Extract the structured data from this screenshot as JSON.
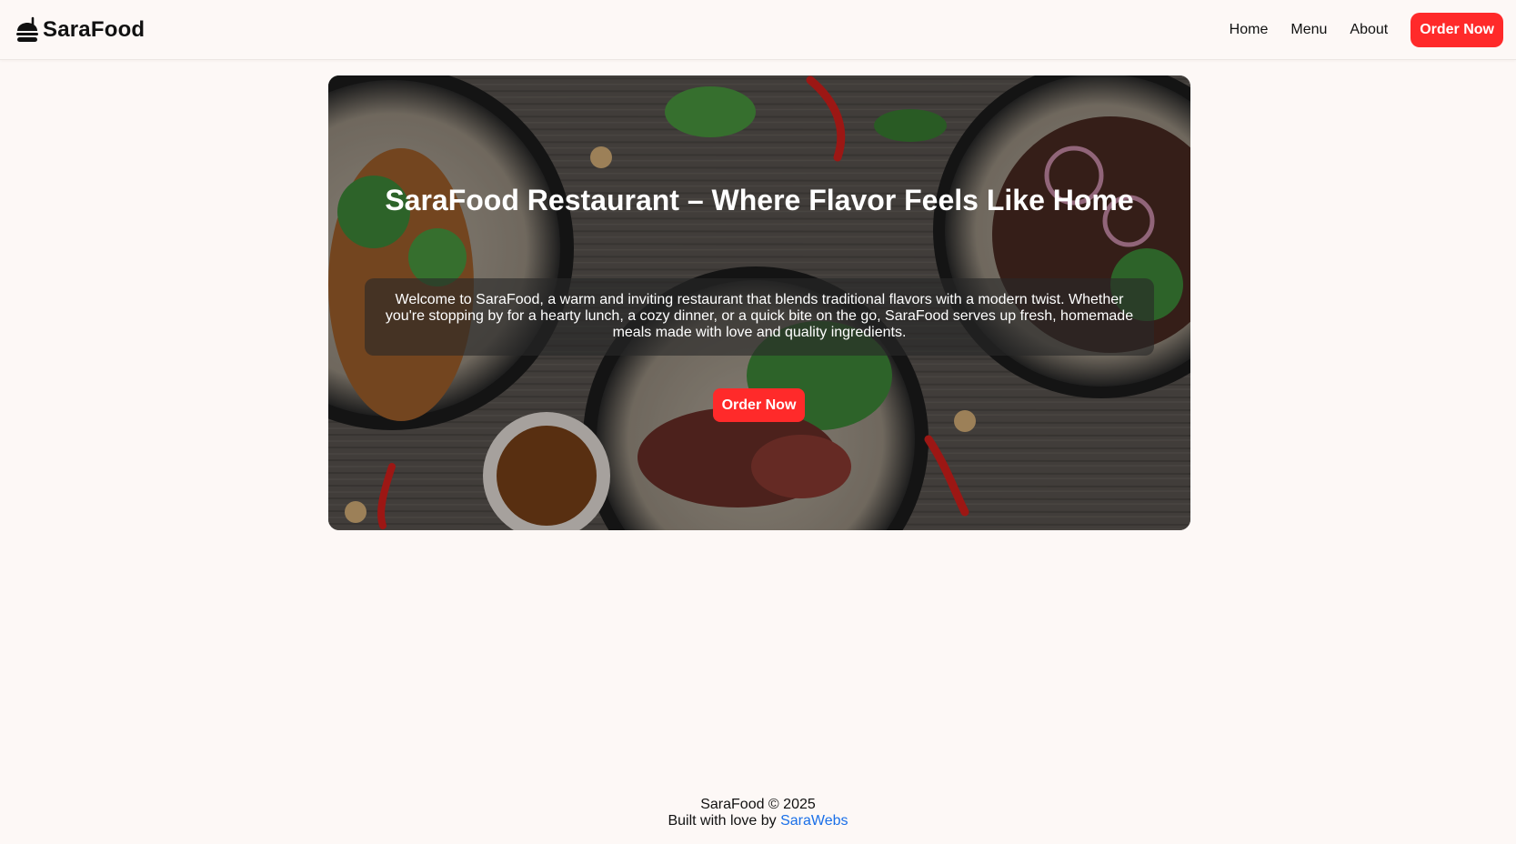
{
  "nav": {
    "brand": "SaraFood",
    "links": [
      "Home",
      "Menu",
      "About"
    ],
    "cta": "Order Now"
  },
  "hero": {
    "title": "SaraFood Restaurant – Where Flavor Feels Like Home",
    "description": "Welcome to SaraFood, a warm and inviting restaurant that blends traditional flavors with a modern twist. Whether you're stopping by for a hearty lunch, a cozy dinner, or a quick bite on the go, SaraFood serves up fresh, homemade meals made with love and quality ingredients.",
    "cta": "Order Now"
  },
  "footer": {
    "copyright": "SaraFood © 2025",
    "built_prefix": "Built with love by",
    "built_link": "SaraWebs"
  },
  "colors": {
    "accent": "#ff2a2a",
    "link": "#1a6fe8",
    "background": "#fdf8f6"
  },
  "icons": {
    "brand": "burger-icon"
  }
}
